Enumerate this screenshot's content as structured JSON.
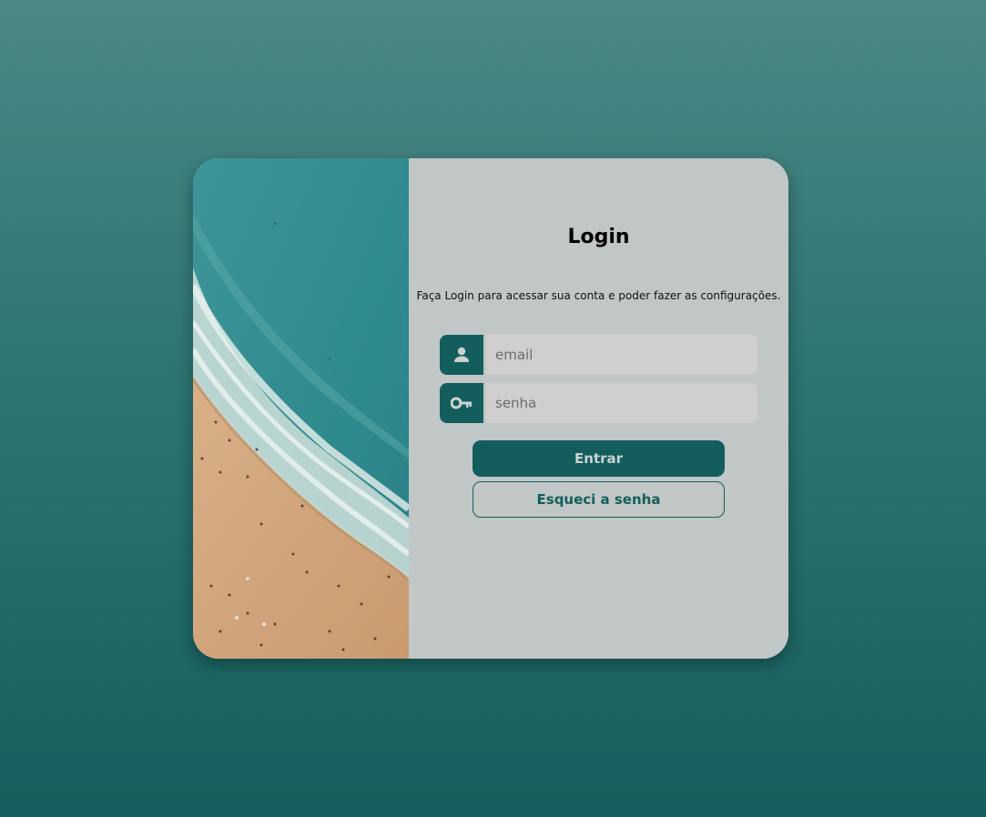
{
  "login": {
    "title": "Login",
    "subtitle": "Faça Login para acessar sua conta e poder fazer as configurações.",
    "email": {
      "placeholder": "email",
      "icon": "user-icon"
    },
    "senha": {
      "placeholder": "senha",
      "icon": "key-icon"
    },
    "submit_label": "Entrar",
    "forgot_label": "Esqueci a senha"
  },
  "colors": {
    "accent": "#135e5d",
    "panel": "#c1c6c6",
    "input": "#d0cfcf"
  }
}
